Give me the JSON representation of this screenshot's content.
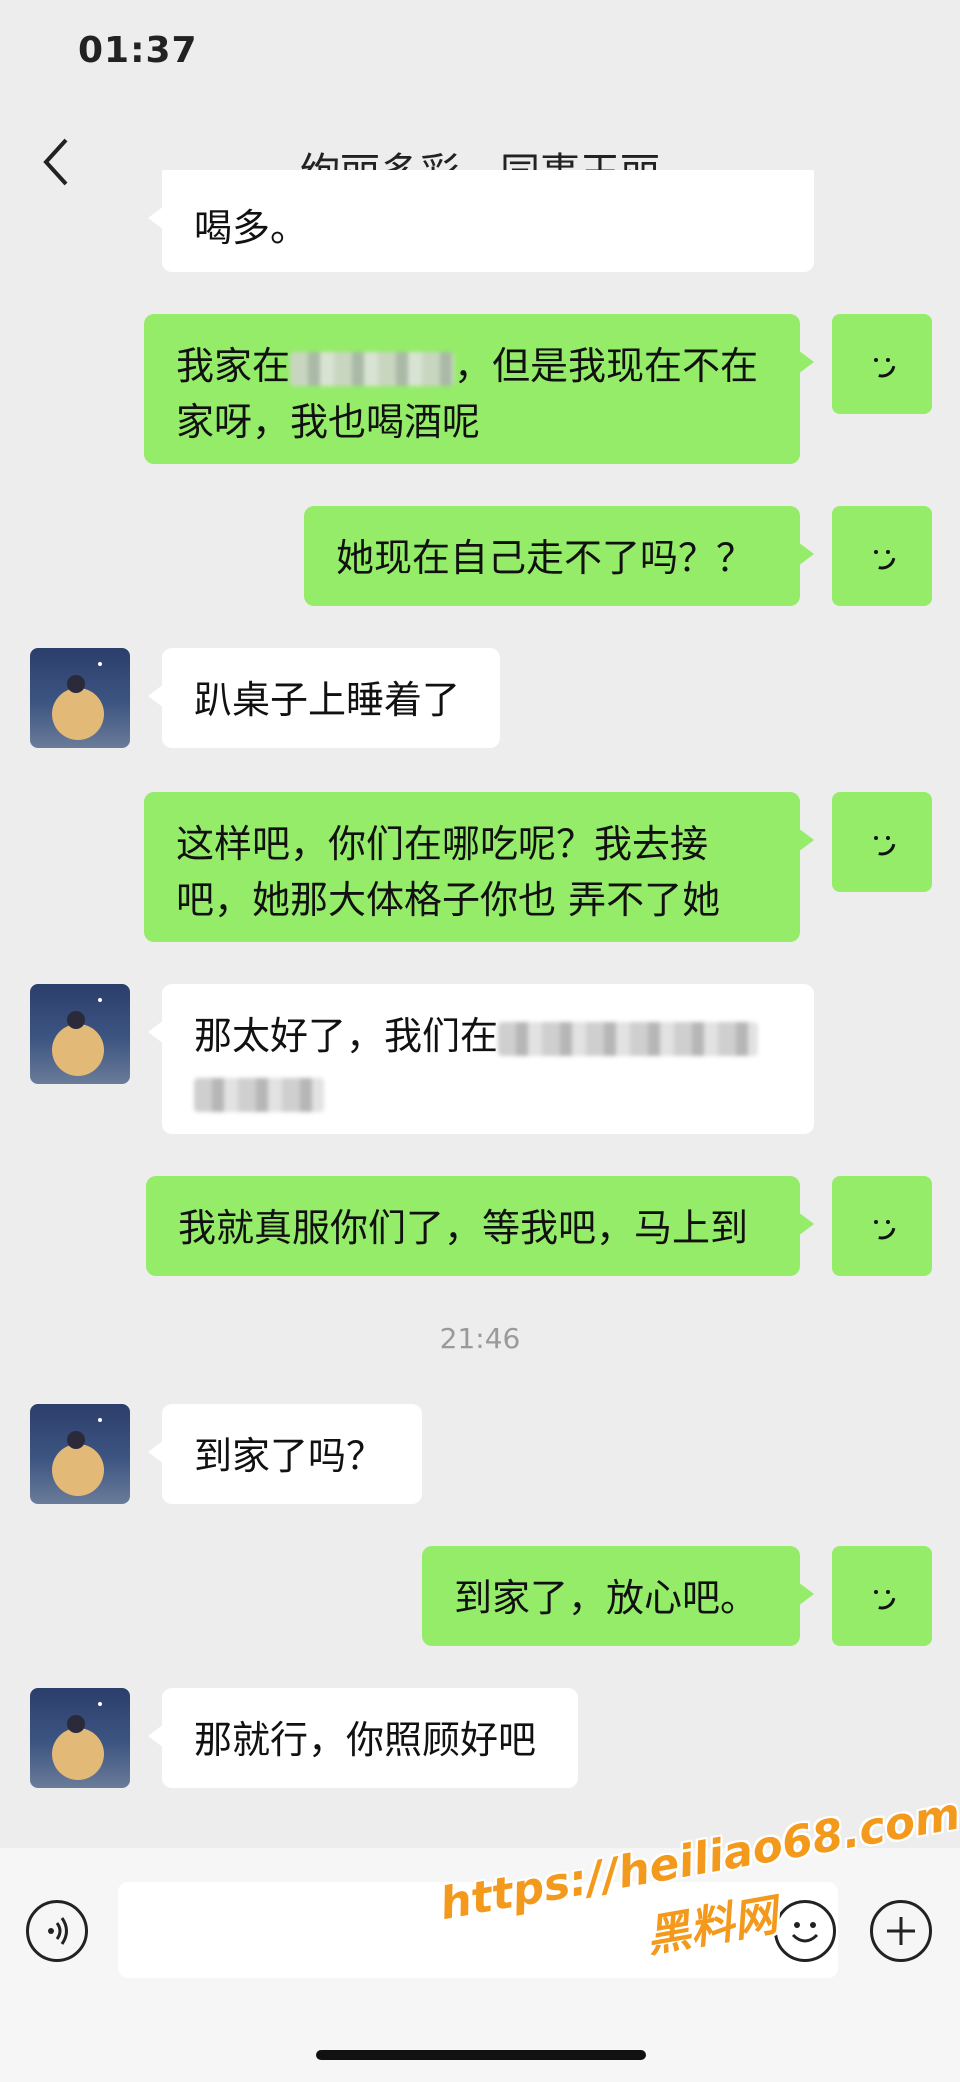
{
  "status_bar": {
    "time": "01:37"
  },
  "header": {
    "title": "绚丽多彩—同事王丽"
  },
  "messages": [
    {
      "text": "喝多。"
    },
    {
      "text_pre": "我家在",
      "text_post": "，但是我现在不在家呀，我也喝酒呢"
    },
    {
      "text": "她现在自己走不了吗？？"
    },
    {
      "text": "趴桌子上睡着了"
    },
    {
      "text": "这样吧，你们在哪吃呢？我去接吧，她那大体格子你也 弄不了她"
    },
    {
      "text_pre": "那太好了，我们在"
    },
    {
      "text": "我就真服你们了，等我吧，马上到"
    },
    {
      "text": "到家了吗？"
    },
    {
      "text": "到家了，放心吧。"
    },
    {
      "text": "那就行，你照顾好吧"
    }
  ],
  "timestamp": "21:46",
  "watermark": {
    "url": "https://heiliao68.com",
    "name": "黑料网"
  },
  "icons": {
    "back": "chevron-left-icon",
    "voice": "voice-icon",
    "emoji": "emoji-icon",
    "add": "plus-icon"
  },
  "colors": {
    "outgoing": "#95ec69",
    "incoming": "#ffffff",
    "background": "#ededed"
  }
}
